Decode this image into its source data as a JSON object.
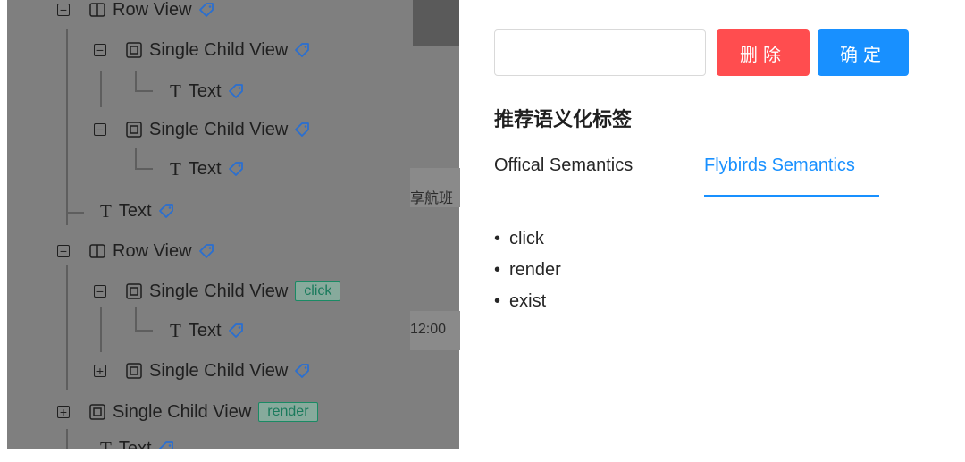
{
  "tree": {
    "nodes": [
      {
        "label": "Row View",
        "kind": "row",
        "expander": "−",
        "semantic": null
      },
      {
        "label": "Single Child View",
        "kind": "single",
        "expander": "−",
        "semantic": null
      },
      {
        "label": "Text",
        "kind": "text",
        "expander": null,
        "semantic": null
      },
      {
        "label": "Single Child View",
        "kind": "single",
        "expander": "−",
        "semantic": null
      },
      {
        "label": "Text",
        "kind": "text",
        "expander": null,
        "semantic": null
      },
      {
        "label": "Text",
        "kind": "text",
        "expander": null,
        "semantic": null
      },
      {
        "label": "Row View",
        "kind": "row",
        "expander": "−",
        "semantic": null
      },
      {
        "label": "Single Child View",
        "kind": "single",
        "expander": "−",
        "semantic": "click"
      },
      {
        "label": "Text",
        "kind": "text",
        "expander": null,
        "semantic": null
      },
      {
        "label": "Single Child View",
        "kind": "single",
        "expander": "+",
        "semantic": null
      },
      {
        "label": "Single Child View",
        "kind": "single",
        "expander": "+",
        "semantic": "render"
      },
      {
        "label": "Text",
        "kind": "text",
        "expander": null,
        "semantic": null
      }
    ]
  },
  "background_fragments": {
    "flight_text": "享航班",
    "time_text": "12:00"
  },
  "editor": {
    "input_value": "",
    "delete_label": "删除",
    "confirm_label": "确定"
  },
  "recommend": {
    "title": "推荐语义化标签",
    "tabs": [
      {
        "label": "Offical Semantics",
        "active": false
      },
      {
        "label": "Flybirds Semantics",
        "active": true
      }
    ],
    "items": [
      "click",
      "render",
      "exist"
    ]
  },
  "colors": {
    "delete": "#ff4d4f",
    "confirm": "#1890ff",
    "active_tab": "#1890ff",
    "semantic_tag": "#1a7a5c"
  }
}
